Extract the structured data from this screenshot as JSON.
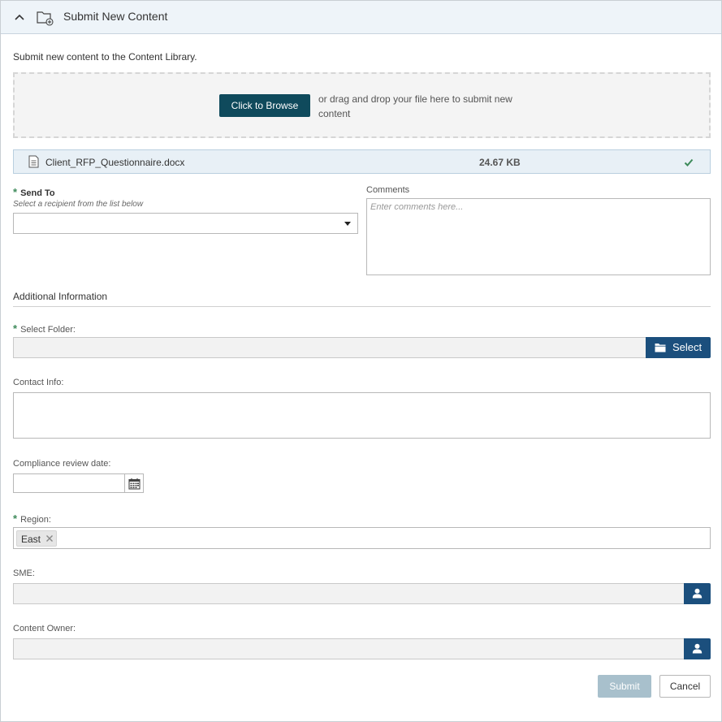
{
  "header": {
    "title": "Submit New Content",
    "collapse_icon": "chevron-up-icon",
    "folder_icon": "folder-add-icon"
  },
  "intro_text": "Submit new content to the Content Library.",
  "dropzone": {
    "browse_label": "Click to Browse",
    "drop_text": "or drag and drop your file here to submit new content"
  },
  "file": {
    "icon": "document-icon",
    "name": "Client_RFP_Questionnaire.docx",
    "size": "24.67 KB",
    "status_icon": "checkmark-icon",
    "status_color": "#3d8a5a"
  },
  "send_to": {
    "required_mark": "*",
    "label": "Send To",
    "hint": "Select a recipient from the list below",
    "value": ""
  },
  "comments": {
    "label": "Comments",
    "placeholder": "Enter comments here..."
  },
  "additional": {
    "title": "Additional Information",
    "folder": {
      "required_mark": "*",
      "label": "Select Folder:",
      "value": "",
      "button_label": "Select",
      "button_icon": "folder-icon"
    },
    "contact": {
      "label": "Contact Info:",
      "value": ""
    },
    "compliance": {
      "label": "Compliance review date:",
      "value": "",
      "icon": "calendar-icon"
    },
    "region": {
      "required_mark": "*",
      "label": "Region:",
      "tags": [
        "East"
      ]
    },
    "sme": {
      "label": "SME:",
      "value": "",
      "icon": "person-icon"
    },
    "owner": {
      "label": "Content Owner:",
      "value": "",
      "icon": "person-icon"
    }
  },
  "actions": {
    "submit_label": "Submit",
    "cancel_label": "Cancel"
  },
  "colors": {
    "primary_button": "#1b4f7d",
    "browse_button": "#0f4a5c",
    "disabled_submit": "#a8c0cc",
    "required": "#3d8a5a"
  }
}
